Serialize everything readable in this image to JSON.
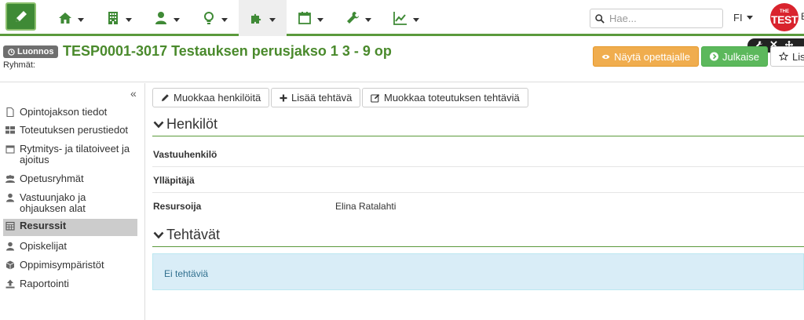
{
  "nav": {
    "items": [
      {
        "name": "home-icon",
        "active": false
      },
      {
        "name": "building-icon",
        "active": false
      },
      {
        "name": "user-icon",
        "active": false
      },
      {
        "name": "lightbulb-icon",
        "active": false
      },
      {
        "name": "puzzle-icon",
        "active": true
      },
      {
        "name": "calendar-icon",
        "active": false
      },
      {
        "name": "wrench-icon",
        "active": false
      },
      {
        "name": "line-chart-icon",
        "active": false
      }
    ],
    "search_placeholder": "Hae...",
    "language": "FI",
    "brand_the": "THE",
    "brand_test": "TEST",
    "brand_extra": "E"
  },
  "header": {
    "status_badge": "Luonnos",
    "title": "TESP0001-3017 Testauksen perusjakso 1 3 - 9 op",
    "groups_label": "Ryhmät:",
    "show_teacher_button": "Näytä opettajalle",
    "publish_button": "Julkaise",
    "list_button": "Lis"
  },
  "sidebar": {
    "collapse_glyph": "«",
    "items": [
      {
        "label": "Opintojakson tiedot",
        "icon": "file-icon",
        "active": false
      },
      {
        "label": "Toteutuksen perustiedot",
        "icon": "grid-icon",
        "active": false
      },
      {
        "label": "Rytmitys- ja tilatoiveet ja ajoitus",
        "icon": "calendar-icon",
        "active": false
      },
      {
        "label": "Opetusryhmät",
        "icon": "users-icon",
        "active": false
      },
      {
        "label": "Vastuunjako ja ohjauksen alat",
        "icon": "user-icon",
        "active": false
      },
      {
        "label": "Resurssit",
        "icon": "calendar-grid-icon",
        "active": true
      },
      {
        "label": "Opiskelijat",
        "icon": "user-icon",
        "active": false
      },
      {
        "label": "Oppimisympäristöt",
        "icon": "cube-icon",
        "active": false
      },
      {
        "label": "Raportointi",
        "icon": "upload-icon",
        "active": false
      }
    ]
  },
  "toolbar": {
    "edit_persons": "Muokkaa henkilöitä",
    "add_task": "Lisää tehtävä",
    "edit_tasks": "Muokkaa toteutuksen tehtäviä"
  },
  "persons": {
    "title": "Henkilöt",
    "rows": [
      {
        "label": "Vastuuhenkilö",
        "value": ""
      },
      {
        "label": "Ylläpitäjä",
        "value": ""
      },
      {
        "label": "Resursoija",
        "value": "Elina Ratalahti"
      }
    ]
  },
  "tasks": {
    "title": "Tehtävät",
    "empty_text": "Ei tehtäviä"
  },
  "colors": {
    "brand_green": "#4a8a2c",
    "nav_underline": "#5b9a3c",
    "warning": "#f0ad4e",
    "success": "#5cb85c",
    "info_bg": "#d9edf7",
    "brand_red": "#d9232d"
  }
}
